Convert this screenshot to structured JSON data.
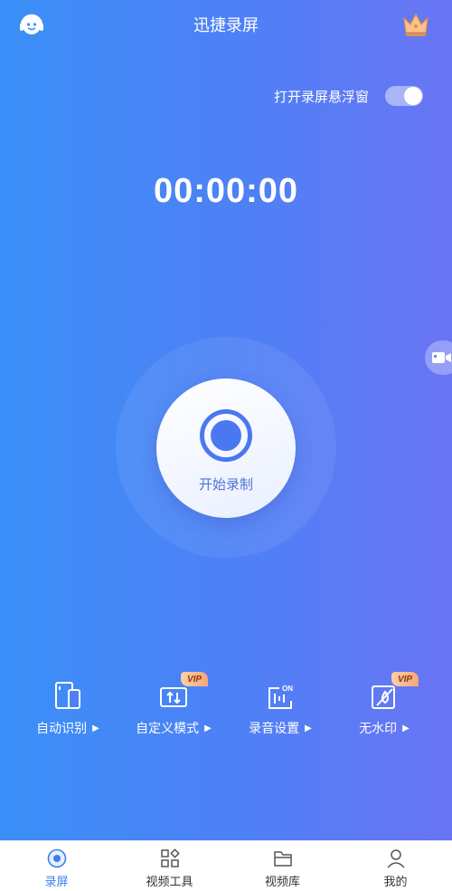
{
  "header": {
    "title": "迅捷录屏",
    "left_icon": "customer-service-icon",
    "right_icon": "vip-crown-icon"
  },
  "floating_window": {
    "label": "打开录屏悬浮窗",
    "enabled": true
  },
  "timer": "00:00:00",
  "record_button": {
    "label": "开始录制",
    "icon": "record-icon"
  },
  "side_button": {
    "icon": "video-camera-icon"
  },
  "tools": [
    {
      "label": "自动识别",
      "icon": "auto-detect-icon",
      "vip": false
    },
    {
      "label": "自定义模式",
      "icon": "custom-mode-icon",
      "vip": true,
      "badge": "VIP"
    },
    {
      "label": "录音设置",
      "icon": "audio-settings-icon",
      "vip": false
    },
    {
      "label": "无水印",
      "icon": "no-watermark-icon",
      "vip": true,
      "badge": "VIP"
    }
  ],
  "nav": [
    {
      "label": "录屏",
      "icon": "record-screen-icon",
      "active": true
    },
    {
      "label": "视频工具",
      "icon": "video-tools-icon",
      "active": false
    },
    {
      "label": "视频库",
      "icon": "folder-icon",
      "active": false
    },
    {
      "label": "我的",
      "icon": "profile-icon",
      "active": false
    }
  ],
  "colors": {
    "accent": "#3a7ff2",
    "gradient_start": "#3a8ff7",
    "gradient_end": "#6a75f4"
  }
}
